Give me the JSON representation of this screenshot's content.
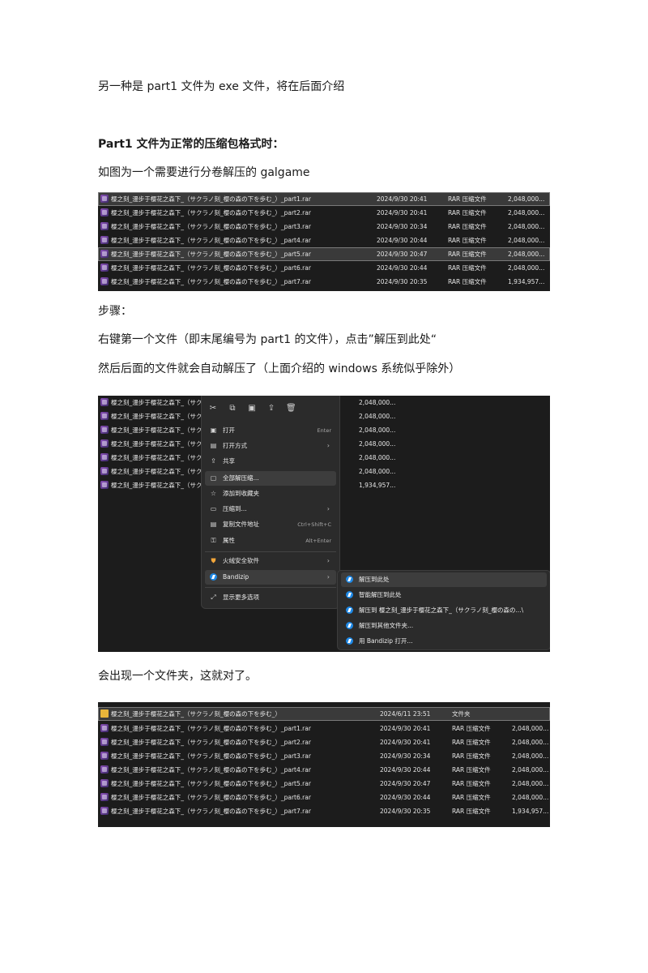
{
  "intro_line": "另一种是 part1 文件为 exe 文件，将在后面介绍",
  "heading": "Part1 文件为正常的压缩包格式时：",
  "caption1": "如图为一个需要进行分卷解压的 galgame",
  "steps_label": "步骤：",
  "step1": "右键第一个文件（即末尾编号为 part1 的文件），点击”解压到此处“",
  "step2": "然后后面的文件就会自动解压了（上面介绍的 windows 系统似乎除外）",
  "caption2": "会出现一个文件夹，这就对了。",
  "files": [
    {
      "name": "樱之刻_漫步于樱花之森下_（サクラノ刻_櫻の森の下を歩む_）_part1.rar",
      "date": "2024/9/30 20:41",
      "type": "RAR 压缩文件",
      "size": "2,048,000..."
    },
    {
      "name": "樱之刻_漫步于樱花之森下_（サクラノ刻_櫻の森の下を歩む_）_part2.rar",
      "date": "2024/9/30 20:41",
      "type": "RAR 压缩文件",
      "size": "2,048,000..."
    },
    {
      "name": "樱之刻_漫步于樱花之森下_（サクラノ刻_櫻の森の下を歩む_）_part3.rar",
      "date": "2024/9/30 20:34",
      "type": "RAR 压缩文件",
      "size": "2,048,000..."
    },
    {
      "name": "樱之刻_漫步于樱花之森下_（サクラノ刻_櫻の森の下を歩む_）_part4.rar",
      "date": "2024/9/30 20:44",
      "type": "RAR 压缩文件",
      "size": "2,048,000..."
    },
    {
      "name": "樱之刻_漫步于樱花之森下_（サクラノ刻_櫻の森の下を歩む_）_part5.rar",
      "date": "2024/9/30 20:47",
      "type": "RAR 压缩文件",
      "size": "2,048,000..."
    },
    {
      "name": "樱之刻_漫步于樱花之森下_（サクラノ刻_櫻の森の下を歩む_）_part6.rar",
      "date": "2024/9/30 20:44",
      "type": "RAR 压缩文件",
      "size": "2,048,000..."
    },
    {
      "name": "樱之刻_漫步于樱花之森下_（サクラノ刻_櫻の森の下を歩む_）_part7.rar",
      "date": "2024/9/30 20:35",
      "type": "RAR 压缩文件",
      "size": "1,934,957..."
    }
  ],
  "shot2_partial_name": "樱之刻_漫步于樱花之森下_（サク",
  "context_menu": {
    "items": [
      {
        "icon": "open-icon",
        "label": "打开",
        "key": "Enter"
      },
      {
        "icon": "open-with-icon",
        "label": "打开方式",
        "arrow": "›"
      },
      {
        "icon": "share-icon",
        "label": "共享"
      },
      {
        "icon": "extract-all-icon",
        "label": "全部解压缩..."
      },
      {
        "icon": "favorite-icon",
        "label": "添加到收藏夹"
      },
      {
        "icon": "compress-icon",
        "label": "压缩到...",
        "arrow": "›"
      },
      {
        "icon": "copy-path-icon",
        "label": "复制文件地址",
        "key": "Ctrl+Shift+C"
      },
      {
        "icon": "properties-icon",
        "label": "属性",
        "key": "Alt+Enter"
      },
      {
        "icon": "huorong-icon",
        "label": "火绒安全软件",
        "arrow": "›"
      },
      {
        "icon": "bandizip-icon",
        "label": "Bandizip",
        "arrow": "›"
      },
      {
        "icon": "more-options-icon",
        "label": "显示更多选项"
      }
    ],
    "submenu": [
      "解压到此处",
      "智能解压到此处",
      "解压到 樱之刻_漫步于樱花之森下_（サクラノ刻_櫻の森の...\\",
      "解压到其他文件夹...",
      "用 Bandizip 打开..."
    ]
  },
  "folder_row": {
    "name": "樱之刻_漫步于樱花之森下_（サクラノ刻_櫻の森の下を歩む_）",
    "date": "2024/6/11 23:51",
    "type": "文件夹",
    "size": ""
  }
}
